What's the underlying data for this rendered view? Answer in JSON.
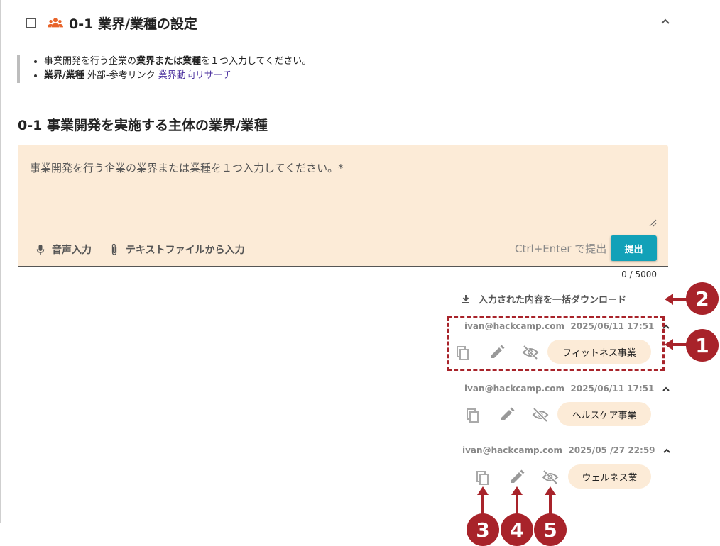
{
  "section": {
    "title": "0-1 業界/業種の設定",
    "notes": {
      "line1_pre": "事業開発を行う企業の",
      "line1_bold": "業界または業種",
      "line1_post": "を１つ入力してください。",
      "line2_bold": "業界/業種",
      "line2_text": " 外部-参考リンク ",
      "line2_link": "業界動向リサーチ"
    }
  },
  "question": {
    "title": "0-1 事業開発を実施する主体の業界/業種",
    "placeholder": "事業開発を行う企業の業界または業種を１つ入力してください。*",
    "voice_label": "音声入力",
    "file_label": "テキストファイルから入力",
    "submit_hint": "Ctrl+Enter で提出",
    "submit_label": "提出",
    "counter": "0 / 5000"
  },
  "download_label": "入力された内容を一括ダウンロード",
  "entries": [
    {
      "user": "ivan@hackcamp.com",
      "time": "2025/06/11 17:51",
      "value": "フィットネス事業"
    },
    {
      "user": "ivan@hackcamp.com",
      "time": "2025/06/11 17:51",
      "value": "ヘルスケア事業"
    },
    {
      "user": "ivan@hackcamp.com",
      "time": "2025/05 /27 22:59",
      "value": "ウェルネス業"
    }
  ],
  "callouts": [
    "1",
    "2",
    "3",
    "4",
    "5"
  ],
  "colors": {
    "accent": "#a8232a",
    "submit": "#12a1b8",
    "input_bg": "#fcebd7",
    "group_icon": "#e8642a"
  },
  "icons": [
    "checkbox-icon",
    "group-icon",
    "chevron-up-icon",
    "mic-icon",
    "paperclip-icon",
    "download-icon",
    "copy-icon",
    "edit-icon",
    "visibility-off-icon"
  ]
}
